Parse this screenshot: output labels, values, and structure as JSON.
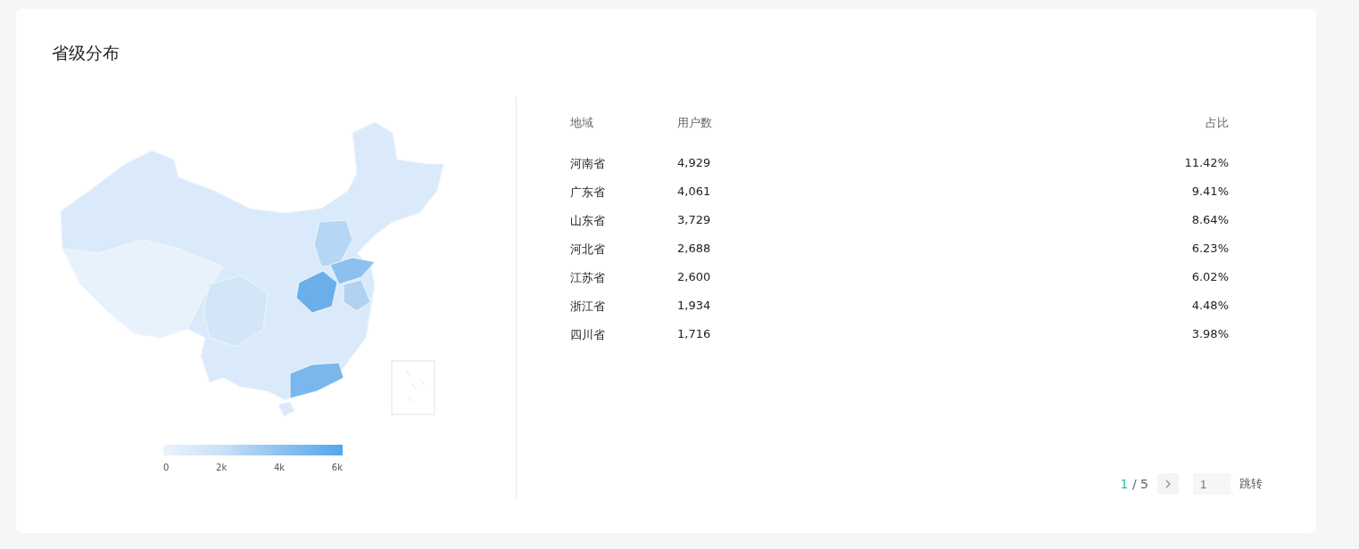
{
  "title": "省级分布",
  "legend": {
    "ticks": [
      "0",
      "2k",
      "4k",
      "6k"
    ]
  },
  "table": {
    "columns": [
      "地域",
      "用户数",
      "占比"
    ],
    "rows": [
      {
        "region": "河南省",
        "users": "4,929",
        "share": "11.42%"
      },
      {
        "region": "广东省",
        "users": "4,061",
        "share": "9.41%"
      },
      {
        "region": "山东省",
        "users": "3,729",
        "share": "8.64%"
      },
      {
        "region": "河北省",
        "users": "2,688",
        "share": "6.23%"
      },
      {
        "region": "江苏省",
        "users": "2,600",
        "share": "6.02%"
      },
      {
        "region": "浙江省",
        "users": "1,934",
        "share": "4.48%"
      },
      {
        "region": "四川省",
        "users": "1,716",
        "share": "3.98%"
      }
    ]
  },
  "pagination": {
    "current": "1",
    "separator": "/",
    "total": "5",
    "jump_placeholder": "1",
    "jump_button": "跳转"
  }
}
